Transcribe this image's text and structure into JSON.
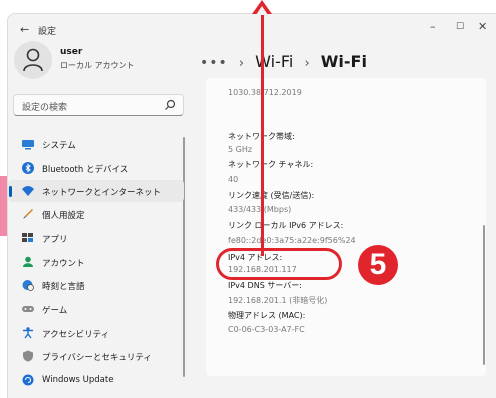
{
  "window": {
    "back_label": "←",
    "title": "設定",
    "minimize": "–",
    "maximize": "☐",
    "close": "✕"
  },
  "user": {
    "name": "user",
    "account_type": "ローカル アカウント"
  },
  "search": {
    "placeholder": "設定の検索"
  },
  "sidebar": {
    "items": [
      {
        "label": "システム",
        "icon": "monitor-icon",
        "selected": false
      },
      {
        "label": "Bluetooth とデバイス",
        "icon": "bluetooth-icon",
        "selected": false
      },
      {
        "label": "ネットワークとインターネット",
        "icon": "wifi-icon",
        "selected": true
      },
      {
        "label": "個人用設定",
        "icon": "brush-icon",
        "selected": false
      },
      {
        "label": "アプリ",
        "icon": "apps-icon",
        "selected": false
      },
      {
        "label": "アカウント",
        "icon": "person-icon",
        "selected": false
      },
      {
        "label": "時刻と言語",
        "icon": "globe-clock-icon",
        "selected": false
      },
      {
        "label": "ゲーム",
        "icon": "gamepad-icon",
        "selected": false
      },
      {
        "label": "アクセシビリティ",
        "icon": "accessibility-icon",
        "selected": false
      },
      {
        "label": "プライバシーとセキュリティ",
        "icon": "shield-icon",
        "selected": false
      },
      {
        "label": "Windows Update",
        "icon": "update-icon",
        "selected": false
      }
    ]
  },
  "breadcrumb": {
    "overflow": "•••",
    "sep": "›",
    "parent": "Wi-Fi",
    "current": "Wi-Fi"
  },
  "properties": {
    "driver_version": "1030.38.712.2019",
    "band_label": "ネットワーク帯域:",
    "band_value": "5 GHz",
    "channel_label": "ネットワーク チャネル:",
    "channel_value": "40",
    "link_speed_label": "リンク速度 (受信/送信):",
    "link_speed_value": "433/433 (Mbps)",
    "ipv6_label": "リンク ローカル IPv6 アドレス:",
    "ipv6_value": "fe80::2de0:3a75:a22e:9f56%24",
    "ipv4_label": "IPv4 アドレス:",
    "ipv4_value": "192.168.201.117",
    "dns_label": "IPv4 DNS サーバー:",
    "dns_value": "192.168.201.1 (非暗号化)",
    "mac_label": "物理アドレス (MAC):",
    "mac_value": "C0-06-C3-03-A7-FC"
  },
  "annotation": {
    "step_number": "5",
    "color": "#e0252d"
  },
  "colors": {
    "accent": "#005fb8",
    "annotation_red": "#e0252d",
    "pink_strip": "#f08aa8"
  }
}
